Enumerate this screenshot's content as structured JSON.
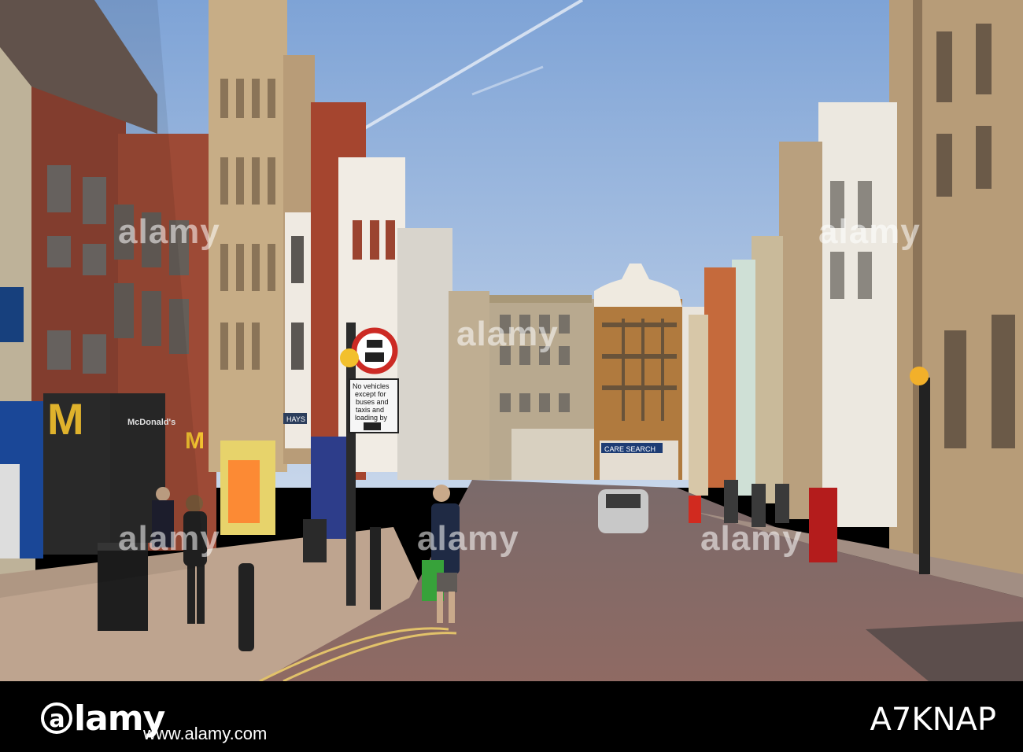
{
  "photo": {
    "signs": {
      "mcdonalds_letter": "M",
      "mcdonalds_name": "McDonald's",
      "shop_sign": "HAYS",
      "no_vehicles": [
        "No vehicles",
        "except for",
        "buses and",
        "taxis and",
        "loading by"
      ],
      "search_shop": "CARE  SEARCH"
    },
    "watermarks": [
      "alamy",
      "alamy",
      "alamy",
      "alamy",
      "alamy",
      "alamy"
    ]
  },
  "footer": {
    "logo_letter": "a",
    "logo_rest": "lamy",
    "site": "www.alamy.com",
    "image_id": "A7KNAP"
  },
  "colors": {
    "sky": "#7fa5d8",
    "road": "#8a6a66",
    "pavement": "#b8a292",
    "brick": "#9a4a3a",
    "stone": "#c9b08a"
  }
}
